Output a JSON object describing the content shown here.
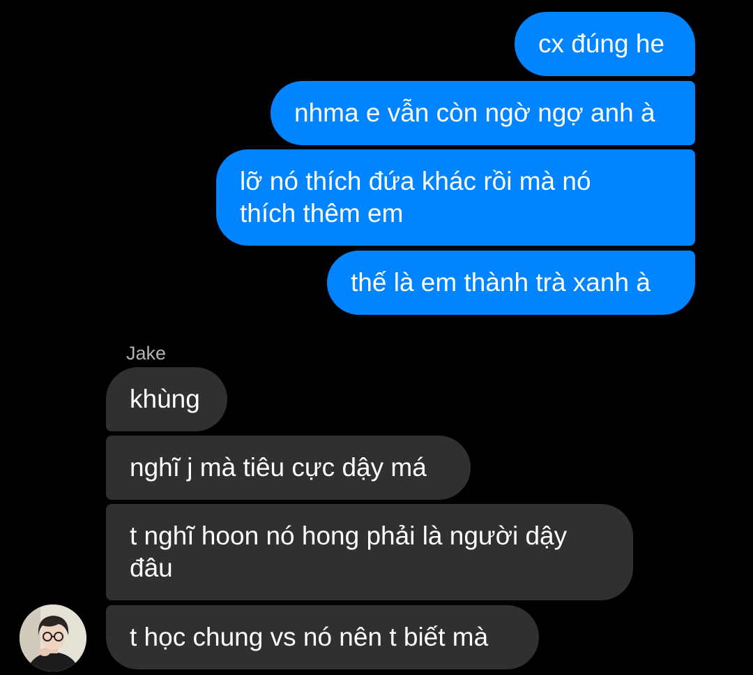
{
  "conversation": {
    "outgoing": [
      {
        "text": "cx đúng he"
      },
      {
        "text": "nhma e vẫn còn ngờ ngợ anh à"
      },
      {
        "text": "lỡ nó thích đứa khác rồi mà nó\nthích thêm em"
      },
      {
        "text": "thế là em thành trà xanh à"
      }
    ],
    "sender_name": "Jake",
    "incoming": [
      {
        "text": "khùng"
      },
      {
        "text": "nghĩ j mà tiêu cực dậy má"
      },
      {
        "text": "t nghĩ hoon nó hong phải là người dậy\nđâu"
      },
      {
        "text": "t học chung vs nó nên t biết mà"
      }
    ]
  },
  "colors": {
    "background": "#000000",
    "outgoing_bubble": "#0084ff",
    "incoming_bubble": "#303030",
    "sender_name": "#b0b3b8"
  },
  "icons": {
    "avatar": "user-avatar-photo"
  }
}
